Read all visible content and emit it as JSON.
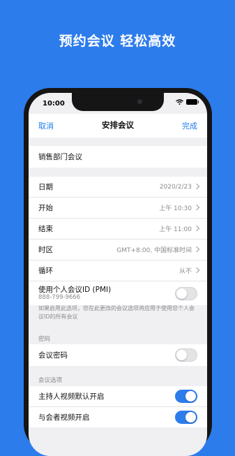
{
  "headline": "预约会议 轻松高效",
  "status_bar": {
    "time": "10:00"
  },
  "nav": {
    "cancel": "取消",
    "title": "安排会议",
    "done": "完成"
  },
  "topic": "销售部门会议",
  "schedule": {
    "date_label": "日期",
    "date_value": "2020/2/23",
    "start_label": "开始",
    "start_value": "上午 10:30",
    "end_label": "结束",
    "end_value": "上午 11:00",
    "timezone_label": "时区",
    "timezone_value": "GMT+8:00, 中国标准时间",
    "repeat_label": "循环",
    "repeat_value": "从不",
    "pmi_label": "使用个人会议ID (PMI)",
    "pmi_number": "888-799-9666",
    "pmi_enabled": false
  },
  "pmi_note": "如果启用此选项，您在此更改的会议选项将应用于使用您个人会议ID的所有会议",
  "password_section": {
    "header": "密码",
    "label": "会议密码",
    "enabled": false
  },
  "options_section": {
    "header": "会议选项",
    "host_video_label": "主持人视频默认开启",
    "host_video_enabled": true,
    "participant_video_label": "与会者视频开启",
    "participant_video_enabled": true
  },
  "colors": {
    "background": "#2d7cec",
    "accent": "#1e7cf0",
    "toggle_on": "#2d7cec"
  }
}
